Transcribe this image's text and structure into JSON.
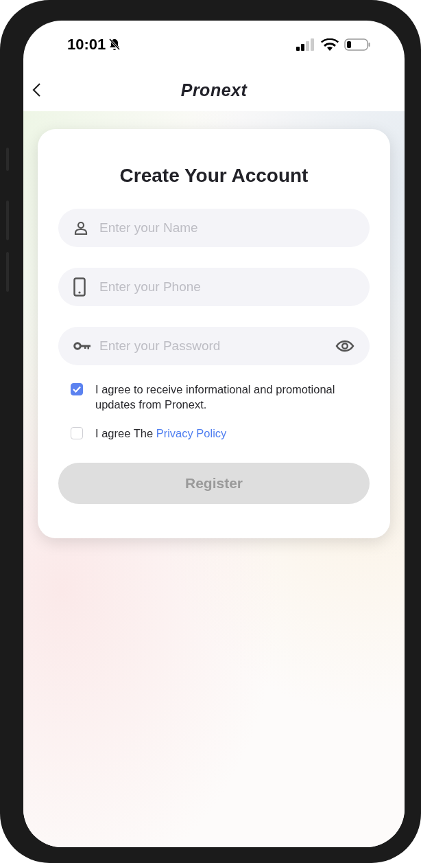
{
  "status_bar": {
    "time": "10:01",
    "silent": true
  },
  "header": {
    "logo": "Pronext"
  },
  "form": {
    "title": "Create Your Account",
    "fields": [
      {
        "kind": "name",
        "placeholder": "Enter your Name"
      },
      {
        "kind": "phone",
        "placeholder": "Enter your Phone"
      },
      {
        "kind": "password",
        "placeholder": "Enter your Password"
      }
    ],
    "consents": [
      {
        "text": "I agree to receive informational and promotional updates from Pronext.",
        "checked": true
      },
      {
        "text": "I agree The ",
        "link": "Privacy Policy",
        "checked": false
      }
    ],
    "submit": {
      "label": "Register",
      "disabled": true
    }
  }
}
